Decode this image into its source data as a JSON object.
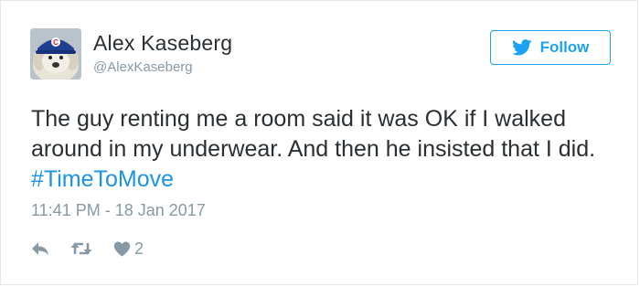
{
  "user": {
    "name": "Alex Kaseberg",
    "handle": "@AlexKaseberg",
    "avatar_icon": "plush-dog-cubs-cap-avatar"
  },
  "follow_button": {
    "label": "Follow",
    "icon": "twitter-bird-icon"
  },
  "tweet": {
    "text": "The guy renting me a room said it was OK if I walked around in my underwear. And then he insisted that I did. ",
    "hashtag": "#TimeToMove",
    "timestamp": "11:41 PM - 18 Jan 2017"
  },
  "actions": {
    "reply_icon": "reply-icon",
    "retweet_icon": "retweet-icon",
    "like_icon": "heart-icon",
    "like_count": "2"
  },
  "colors": {
    "accent": "#1da1f2",
    "hashtag": "#1b95e0",
    "text": "#292f33",
    "muted": "#8899a6",
    "border": "#e1e8ed"
  }
}
